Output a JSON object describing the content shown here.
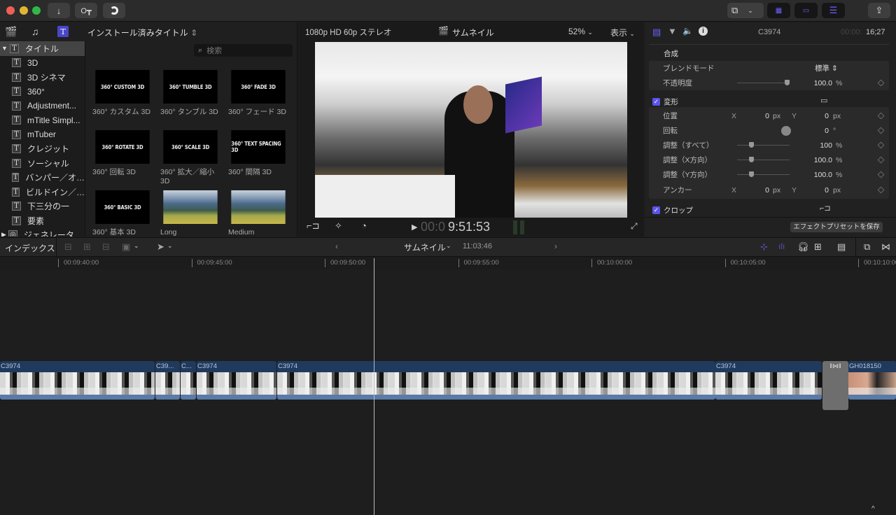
{
  "titlebar": {
    "buttons": [
      "import-icon",
      "keywords-icon",
      "background-tasks-icon"
    ],
    "right_buttons": [
      "workspace-icon",
      "browser-layout-icon",
      "timeline-layout-icon",
      "inspector-layout-icon",
      "share-icon"
    ]
  },
  "browser": {
    "library_icons": [
      "libraries-icon",
      "photos-audio-icon",
      "titles-generators-icon"
    ],
    "title": "インストール済みタイトル",
    "search_placeholder": "検索",
    "sidebar": {
      "root": "タイトル",
      "items": [
        "3D",
        "3D シネマ",
        "360°",
        "Adjustment...",
        "mTitle Simpl...",
        "mTuber",
        "クレジット",
        "ソーシャル",
        "バンパー／オ…",
        "ビルドイン／…",
        "下三分の一",
        "要素"
      ],
      "next_root": "ジェネレータ"
    },
    "tiles": [
      {
        "thumb": "360° CUSTOM 3D",
        "label": "360° カスタム 3D"
      },
      {
        "thumb": "360° TUMBLE 3D",
        "label": "360° タンブル 3D"
      },
      {
        "thumb": "360° FADE 3D",
        "label": "360° フェード 3D"
      },
      {
        "thumb": "360° ROTATE 3D",
        "label": "360° 回転 3D"
      },
      {
        "thumb": "360° SCALE 3D",
        "label": "360° 拡大／縮小 3D"
      },
      {
        "thumb": "360° TEXT SPACING 3D",
        "label": "360° 間隔 3D"
      },
      {
        "thumb": "360° BASIC 3D",
        "label": "360° 基本 3D"
      },
      {
        "thumb": "",
        "label": "Long"
      },
      {
        "thumb": "",
        "label": "Medium"
      }
    ]
  },
  "viewer": {
    "format": "1080p HD 60p ステレオ",
    "project": "サムネイル",
    "zoom": "52%",
    "view": "表示",
    "timecode_dim": "00:0",
    "timecode": "9:51:53"
  },
  "inspector": {
    "clip": "C3974",
    "tc_dim": "00:00:",
    "tc": "16;27",
    "composite": "合成",
    "blend_label": "ブレンドモード",
    "blend_value": "標準",
    "opacity_label": "不透明度",
    "opacity_value": "100.0",
    "opacity_unit": "%",
    "opacity_level": 1.0,
    "transform": "変形",
    "position_label": "位置",
    "x": "X",
    "y": "Y",
    "pos_x": "0",
    "pos_y": "0",
    "px": "px",
    "rotation_label": "回転",
    "rotation_value": "0",
    "deg": "°",
    "scale_all_label": "調整（すべて）",
    "scale_all": "100",
    "scale_x_label": "調整（X方向）",
    "scale_x": "100.0",
    "scale_y_label": "調整（Y方向）",
    "scale_y": "100.0",
    "pct": "%",
    "anchor_label": "アンカー",
    "anchor_x": "0",
    "anchor_y": "0",
    "crop": "クロップ",
    "save_preset": "エフェクトプリセットを保存"
  },
  "timeline": {
    "index": "インデックス",
    "project": "サムネイル",
    "duration": "11:03:46",
    "ruler": [
      "00:09:40:00",
      "00:09:45:00",
      "00:09:50:00",
      "00:09:55:00",
      "00:10:00:00",
      "00:10:05:00",
      "00:10:10:00"
    ],
    "clips": [
      "C3974",
      "C39...",
      "C...",
      "C3974",
      "C3974",
      "C3974",
      "GH018150"
    ]
  }
}
